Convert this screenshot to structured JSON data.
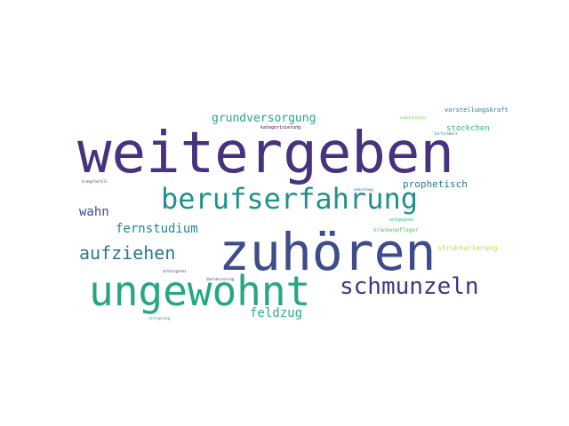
{
  "words": [
    {
      "text": "weitergeben",
      "color": "#46327e"
    },
    {
      "text": "zuhören",
      "color": "#3e4c8a"
    },
    {
      "text": "ungewohnt",
      "color": "#26a784"
    },
    {
      "text": "berufserfahrung",
      "color": "#21918c"
    },
    {
      "text": "schmunzeln",
      "color": "#46327e"
    },
    {
      "text": "aufziehen",
      "color": "#2a788e"
    },
    {
      "text": "fernstudium",
      "color": "#25858e"
    },
    {
      "text": "grundversorgung",
      "color": "#26a784"
    },
    {
      "text": "wahn",
      "color": "#3e4c8a"
    },
    {
      "text": "feldzug",
      "color": "#2ab07f"
    },
    {
      "text": "prophetisch",
      "color": "#2a788e"
    },
    {
      "text": "stockchen",
      "color": "#35b779"
    },
    {
      "text": "strukturierung",
      "color": "#bddf26"
    },
    {
      "text": "vorstellungskraft",
      "color": "#2a788e"
    },
    {
      "text": "krankenpfleger",
      "color": "#4ac16d"
    },
    {
      "text": "entgegnen",
      "color": "#35b779"
    },
    {
      "text": "kategorisierung",
      "color": "#440154"
    },
    {
      "text": "krampfanfall",
      "color": "#3b528b"
    },
    {
      "text": "altersgrenz",
      "color": "#472d7b"
    },
    {
      "text": "zeitsprung",
      "color": "#21918c"
    },
    {
      "text": "überdosierung",
      "color": "#414487"
    },
    {
      "text": "ueberhaug",
      "color": "#2c728e"
    },
    {
      "text": "substitution",
      "color": "#5ec962"
    },
    {
      "text": "tarfschmerz",
      "color": "#2a788e"
    }
  ]
}
